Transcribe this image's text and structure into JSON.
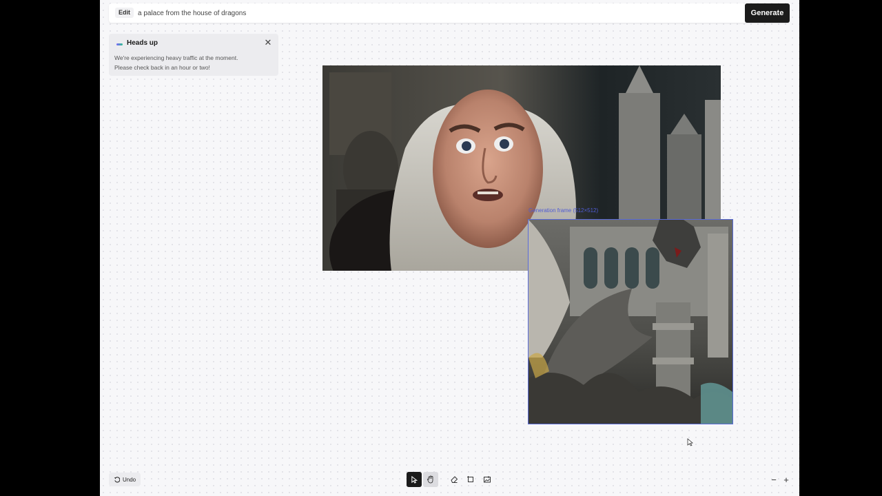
{
  "prompt_bar": {
    "mode_label": "Edit",
    "prompt_value": "a palace from the house of dragons",
    "generate_label": "Generate"
  },
  "toast": {
    "title": "Heads up",
    "message_line1": "We're experiencing heavy traffic at the moment.",
    "message_line2": "Please check back in an hour or two!",
    "close_icon": "close-icon"
  },
  "canvas": {
    "generation_label": "Generation frame (512×512)"
  },
  "bottom": {
    "undo_label": "Undo",
    "tools": [
      "select-tool",
      "hand-tool",
      "eraser-tool",
      "crop-tool",
      "image-upload-tool"
    ],
    "zoom_out": "−",
    "zoom_in": "+"
  },
  "colors": {
    "accent": "#5a6bd8",
    "button_dark": "#1b1b1b",
    "canvas_bg": "#f7f7f9"
  }
}
